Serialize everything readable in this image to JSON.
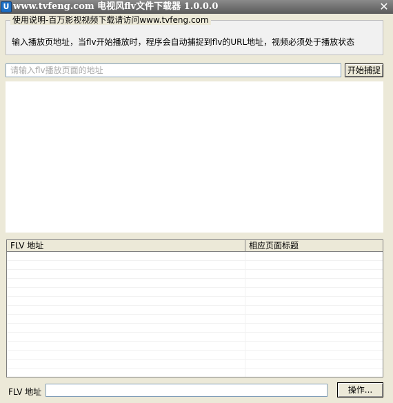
{
  "window": {
    "title": "www.tvfeng.com 电视风flv文件下载器 1.0.0.0",
    "close_glyph": "✕"
  },
  "instructions": {
    "legend": "使用说明-百万影视视频下载请访问www.tvfeng.com",
    "text": "输入播放页地址，当flv开始播放时，程序会自动捕捉到flv的URL地址，视频必须处于播放状态"
  },
  "url_bar": {
    "placeholder": "请输入flv播放页面的地址",
    "value": "",
    "start_button_label": "开始捕捉"
  },
  "results_table": {
    "columns": [
      "FLV 地址",
      "相应页面标题"
    ],
    "rows": []
  },
  "footer": {
    "flv_label": "FLV 地址",
    "flv_value": "",
    "action_button_label": "操作..."
  },
  "colors": {
    "titlebar": "#6e6e6e",
    "window_bg": "#ece9d8",
    "input_border": "#7f9db9"
  }
}
